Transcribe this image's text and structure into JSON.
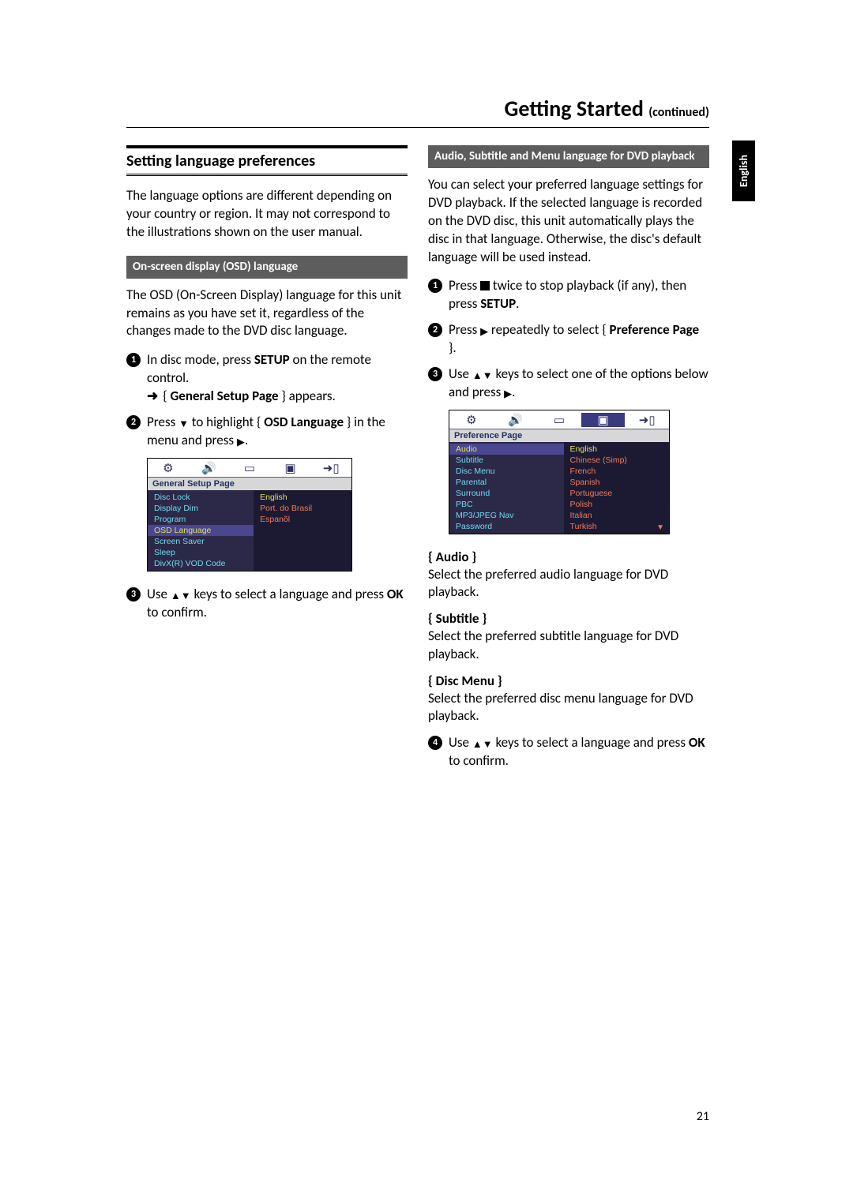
{
  "header": {
    "title": "Getting Started",
    "continued": "(continued)"
  },
  "language_tab": "English",
  "page_number": "21",
  "left": {
    "section_title": "Setting language preferences",
    "intro": "The language options are different depending on your country or region. It may not correspond to the illustrations shown on the user manual.",
    "sub1_heading": "On-screen display (OSD) language",
    "sub1_intro": "The OSD (On-Screen Display) language for this unit remains as you have set it, regardless of the changes made to the DVD disc language.",
    "steps1": {
      "s1_a": "In disc mode, press ",
      "s1_b": "SETUP",
      "s1_c": " on the remote control.",
      "s1_result_a": "{ ",
      "s1_result_b": "General Setup Page",
      "s1_result_c": " } appears.",
      "s2_a": "Press ",
      "s2_b": " to highlight { ",
      "s2_c": "OSD Language",
      "s2_d": " } in the menu and press ",
      "s3_a": "Use ",
      "s3_b": " keys to select a language and press ",
      "s3_c": "OK",
      "s3_d": " to confirm."
    },
    "osd1": {
      "header": "General Setup Page",
      "left_items": [
        "Disc Lock",
        "Display Dim",
        "Program",
        "OSD Language",
        "Screen Saver",
        "Sleep",
        "DivX(R) VOD Code"
      ],
      "selected_left_index": 3,
      "right_items": [
        "English",
        "Port. do Brasil",
        "Espanõl"
      ],
      "selected_right_index": 0
    }
  },
  "right": {
    "sub_heading": "Audio, Subtitle and Menu language for DVD playback",
    "intro": "You can select your preferred language settings for DVD playback. If the selected language is recorded on the DVD disc, this unit automatically plays the disc in that language. Otherwise, the disc's default language will be used instead.",
    "steps": {
      "s1_a": "Press ",
      "s1_b": " twice to stop playback (if any), then press ",
      "s1_c": "SETUP",
      "s1_d": ".",
      "s2_a": "Press ",
      "s2_b": " repeatedly to select { ",
      "s2_c": "Preference Page",
      "s2_d": " }.",
      "s3_a": "Use ",
      "s3_b": " keys to select one of the options below and press ",
      "s4_a": "Use ",
      "s4_b": " keys to select a language and press ",
      "s4_c": "OK",
      "s4_d": " to confirm."
    },
    "osd2": {
      "header": "Preference Page",
      "left_items": [
        "Audio",
        "Subtitle",
        "Disc Menu",
        "Parental",
        "Surround",
        "PBC",
        "MP3/JPEG Nav",
        "Password"
      ],
      "selected_left_index": 0,
      "right_items": [
        "English",
        "Chinese (Simp)",
        "French",
        "Spanish",
        "Portuguese",
        "Polish",
        "Italian",
        "Turkish"
      ],
      "selected_right_index": 0
    },
    "defs": {
      "audio_term": "{ Audio }",
      "audio_text": "Select the preferred audio language for DVD playback.",
      "subtitle_term": "{ Subtitle }",
      "subtitle_text": "Select the preferred subtitle language for DVD playback.",
      "discmenu_term": "{ Disc Menu }",
      "discmenu_text": "Select the preferred disc menu language for DVD playback."
    }
  }
}
